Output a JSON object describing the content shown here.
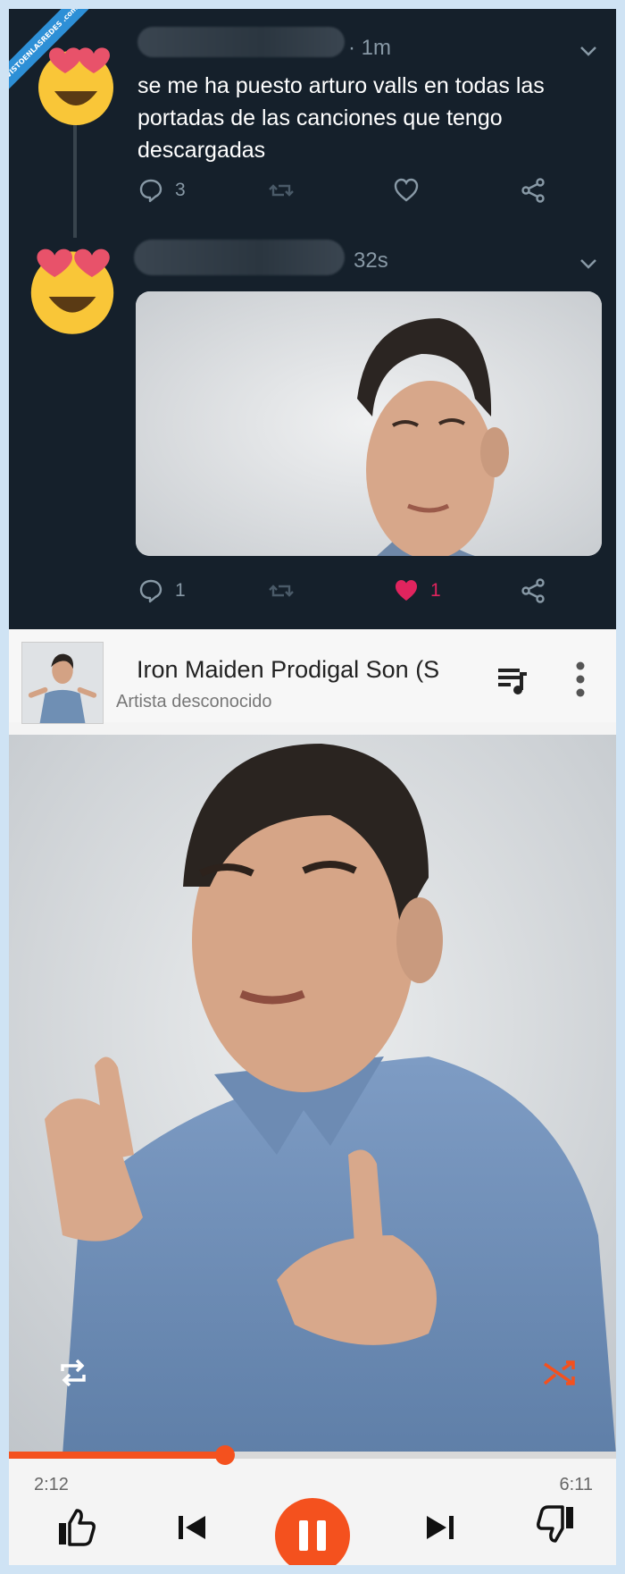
{
  "watermark": {
    "text": "VISTOENLASREDES .com"
  },
  "tweet1": {
    "time": "· 1m",
    "text": "se me ha puesto arturo valls en todas las portadas de las canciones que tengo descargadas",
    "reply_count": "3",
    "like_count": ""
  },
  "tweet2": {
    "time": "32s",
    "reply_count": "1",
    "like_count": "1"
  },
  "player": {
    "song_title": "Iron Maiden Prodigal Son (S",
    "artist": "Artista desconocido",
    "elapsed": "2:12",
    "duration": "6:11",
    "progress": 0.356
  },
  "colors": {
    "twitter_bg": "#15202b",
    "accent": "#f4511e",
    "like": "#e0245e"
  }
}
